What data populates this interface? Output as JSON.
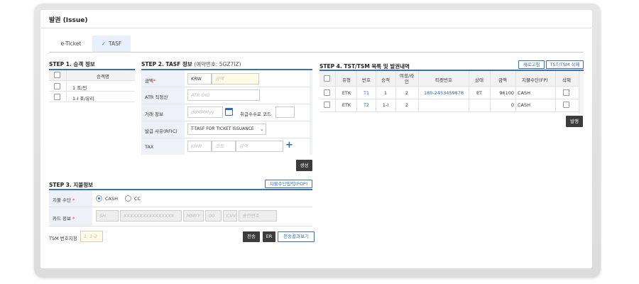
{
  "title": "발권 (Issue)",
  "tabs": [
    {
      "label": "e-Ticket",
      "active": false
    },
    {
      "label": "TASF",
      "active": true,
      "icon": "check-icon"
    }
  ],
  "step1": {
    "title": "STEP 1. 승객 정보",
    "header": "승객명",
    "passengers": [
      "1 조/민",
      "1-I 조/유리"
    ]
  },
  "step2": {
    "title": "STEP 2. TASF 정보",
    "booking_no": "(예약번호: 5GZ7IZ)",
    "amount_label": "금액",
    "currency": "KRW",
    "amount_placeholder": "금액",
    "atr_label": "ATR 직정산",
    "atr_placeholder": "ATR OID",
    "trade_label": "거래 정보",
    "date_placeholder": "ddMMMyy",
    "fee_code_label": "취급수수료 코드",
    "reason_label": "발급 사유(RFIC)",
    "reason_value": "T-TASF FOR TICKET ISSUANCE",
    "tax_label": "TAX",
    "tax_currency_placeholder": "KRW",
    "tax_code_placeholder": "코드",
    "tax_amount_placeholder": "금액",
    "create_button": "생성"
  },
  "step3": {
    "title": "STEP 3. 지불정보",
    "fop_button": "지불수단입력(FOP)",
    "payment_label": "지불 수단",
    "options": [
      "CASH",
      "CC"
    ],
    "selected": "CASH",
    "card_label": "카드 정보",
    "card_placeholders": [
      "SH",
      "XXXXXXXXXXXXXXXX",
      "MMYY",
      "00",
      "CVV",
      "승인번호"
    ]
  },
  "tsm": {
    "label": "TSM 번호지정",
    "placeholder": "1, 1-2",
    "send_button": "전송",
    "er_button": "ER",
    "result_button": "전송결과보기"
  },
  "step4": {
    "title": "STEP 4. TST/TSM 목록 및 발권내역",
    "refresh_button": "새로고침",
    "delete_button": "TST/TSM 삭제",
    "columns": [
      "유형",
      "번호",
      "승객",
      "여정/라인",
      "티켓번호",
      "상태",
      "금액",
      "지불수단(FP)",
      "삭제"
    ],
    "rows": [
      {
        "type": "ETK",
        "no": "T1",
        "pax": "1",
        "seg": "2",
        "ticket": "180-2453459878",
        "status": "ET",
        "amount": "96100",
        "fp": "CASH"
      },
      {
        "type": "ETK",
        "no": "T2",
        "pax": "1-I",
        "seg": "2",
        "ticket": "",
        "status": "",
        "amount": "0",
        "fp": "CASH"
      }
    ],
    "issue_button": "발행"
  },
  "colors": {
    "accent": "#3a6fb0",
    "link": "#2a6cc2",
    "dark_button": "#3c3c3c"
  }
}
